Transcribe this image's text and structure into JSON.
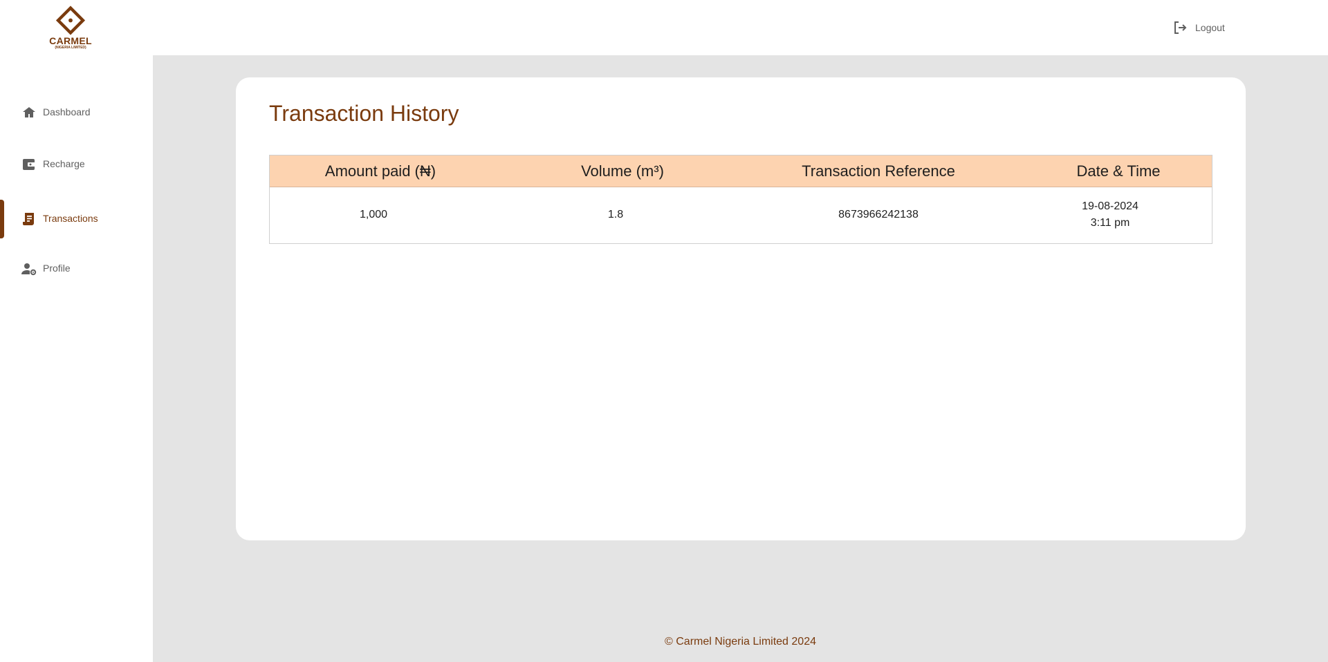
{
  "brand": {
    "name": "CARMEL",
    "sub": "(NIGERIA LIMITED)",
    "color": "#7a3b0e"
  },
  "header": {
    "logout_label": "Logout",
    "logout_icon": "logout-icon"
  },
  "sidebar": {
    "items": [
      {
        "label": "Dashboard",
        "icon": "home-icon",
        "active": false
      },
      {
        "label": "Recharge",
        "icon": "wallet-icon",
        "active": false
      },
      {
        "label": "Transactions",
        "icon": "receipt-icon",
        "active": true
      },
      {
        "label": "Profile",
        "icon": "user-settings-icon",
        "active": false
      }
    ]
  },
  "page": {
    "title": "Transaction History",
    "table": {
      "columns": [
        "Amount paid (₦)",
        "Volume (m³)",
        "Transaction Reference",
        "Date & Time"
      ],
      "header_color": "#fdd3b0",
      "rows": [
        {
          "amount": "1,000",
          "volume": "1.8",
          "reference": "8673966242138",
          "date": "19-08-2024",
          "time": "3:11 pm"
        }
      ]
    }
  },
  "footer": {
    "text": "© Carmel Nigeria Limited 2024"
  }
}
